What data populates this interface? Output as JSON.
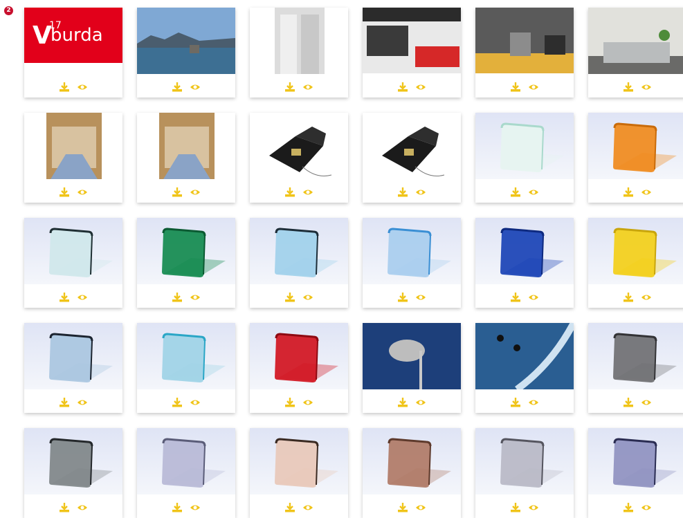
{
  "notification": {
    "count": "2"
  },
  "accent_color": "#f0c419",
  "actions": {
    "download_icon": "download-icon",
    "view_icon": "eye-icon"
  },
  "tiles": [
    {
      "kind": "logo",
      "bg": "#e2001a",
      "text": "burda",
      "subtext": "17"
    },
    {
      "kind": "photo",
      "bg": "#5b87b5"
    },
    {
      "kind": "photo",
      "bg": "#e4e4e4"
    },
    {
      "kind": "photo",
      "bg": "#3b3b3b"
    },
    {
      "kind": "photo",
      "bg": "#d9a441"
    },
    {
      "kind": "photo",
      "bg": "#d8d8d4"
    },
    {
      "kind": "photo",
      "bg": "#c9a06a"
    },
    {
      "kind": "photo",
      "bg": "#c7a36e"
    },
    {
      "kind": "photo",
      "bg": "#ffffff"
    },
    {
      "kind": "photo",
      "bg": "#ffffff"
    },
    {
      "kind": "sheet",
      "color": "#e6f4f0",
      "edge": "#a9d9cc"
    },
    {
      "kind": "sheet",
      "color": "#f08a1c",
      "edge": "#c96b0a"
    },
    {
      "kind": "sheet",
      "color": "#cfe7ea",
      "edge": "#1f2f33"
    },
    {
      "kind": "sheet",
      "color": "#128a4e",
      "edge": "#0b5a32"
    },
    {
      "kind": "sheet",
      "color": "#9fd0ea",
      "edge": "#1d2d38"
    },
    {
      "kind": "sheet",
      "color": "#a8cdee",
      "edge": "#3a8fd4"
    },
    {
      "kind": "sheet",
      "color": "#1942b5",
      "edge": "#0e2a80"
    },
    {
      "kind": "sheet",
      "color": "#f3cf18",
      "edge": "#c8a50c"
    },
    {
      "kind": "sheet",
      "color": "#a9c6e0",
      "edge": "#1c2430"
    },
    {
      "kind": "sheet",
      "color": "#9ed3e6",
      "edge": "#2aa6c6"
    },
    {
      "kind": "sheet",
      "color": "#d11420",
      "edge": "#8e0a12"
    },
    {
      "kind": "photo",
      "bg": "#1d3f7a"
    },
    {
      "kind": "photo",
      "bg": "#2a5e92"
    },
    {
      "kind": "sheet",
      "color": "#6f6f72",
      "edge": "#333336"
    },
    {
      "kind": "sheet",
      "color": "#7f8588",
      "edge": "#24282b"
    },
    {
      "kind": "sheet",
      "color": "#b7b9d6",
      "edge": "#5a5c78"
    },
    {
      "kind": "sheet",
      "color": "#e8c8b8",
      "edge": "#3a2a22"
    },
    {
      "kind": "sheet",
      "color": "#b07a66",
      "edge": "#5e3a2c"
    },
    {
      "kind": "sheet",
      "color": "#b9b9c6",
      "edge": "#55555f"
    },
    {
      "kind": "sheet",
      "color": "#8f91c0",
      "edge": "#2a2c52"
    }
  ]
}
